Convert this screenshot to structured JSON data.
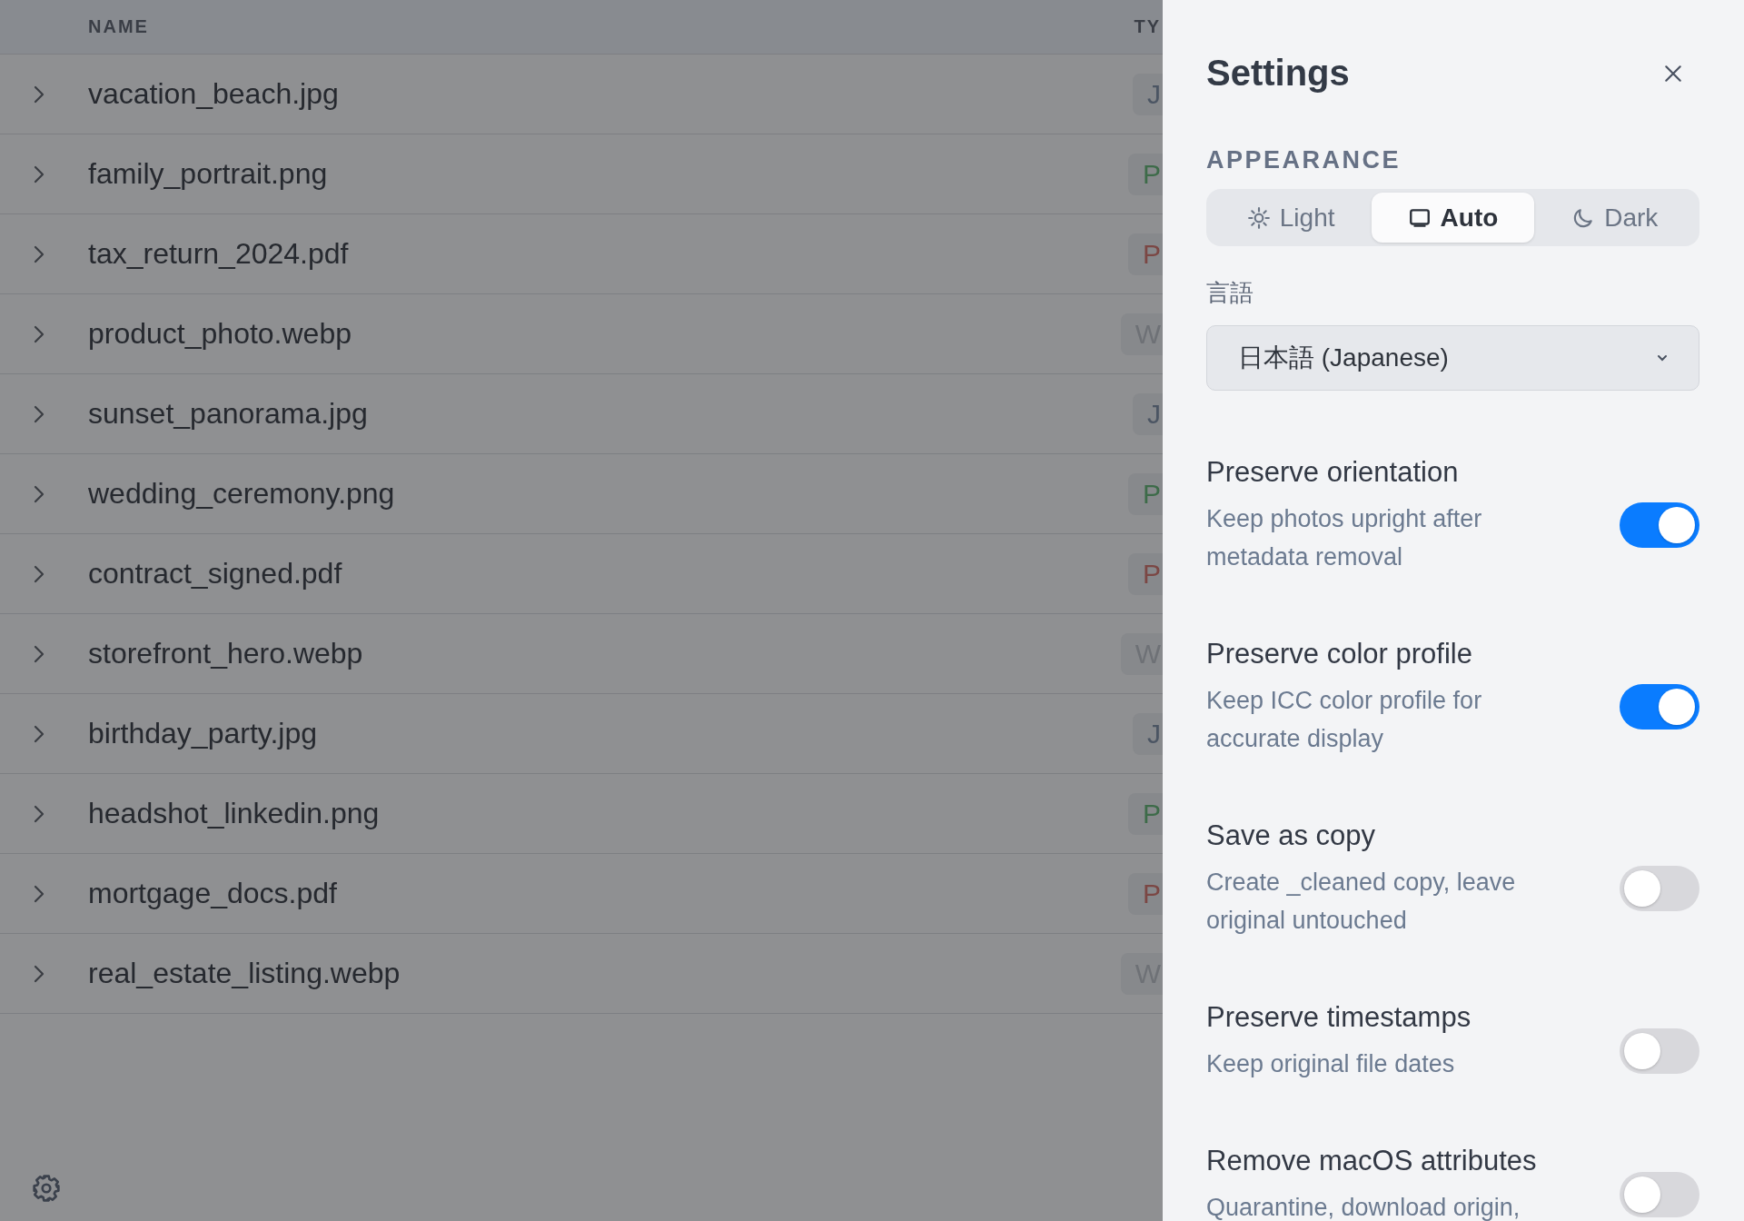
{
  "table": {
    "columns": [
      "NAME",
      "TY"
    ],
    "rows": [
      {
        "name": "vacation_beach.jpg",
        "type": "J",
        "color": "#4b5563"
      },
      {
        "name": "family_portrait.png",
        "type": "P",
        "color": "#3d6b49"
      },
      {
        "name": "tax_return_2024.pdf",
        "type": "P",
        "color": "#7b4744"
      },
      {
        "name": "product_photo.webp",
        "type": "W",
        "color": "#6e7176"
      },
      {
        "name": "sunset_panorama.jpg",
        "type": "J",
        "color": "#4b5563"
      },
      {
        "name": "wedding_ceremony.png",
        "type": "P",
        "color": "#3d6b49"
      },
      {
        "name": "contract_signed.pdf",
        "type": "P",
        "color": "#7b4744"
      },
      {
        "name": "storefront_hero.webp",
        "type": "W",
        "color": "#6e7176"
      },
      {
        "name": "birthday_party.jpg",
        "type": "J",
        "color": "#4b5563"
      },
      {
        "name": "headshot_linkedin.png",
        "type": "P",
        "color": "#3d6b49"
      },
      {
        "name": "mortgage_docs.pdf",
        "type": "P",
        "color": "#7b4744"
      },
      {
        "name": "real_estate_listing.webp",
        "type": "W",
        "color": "#6e7176"
      }
    ]
  },
  "settings": {
    "title": "Settings",
    "appearance_label": "APPEARANCE",
    "themes": [
      {
        "kind": "sun",
        "label": "Light",
        "selected": false
      },
      {
        "kind": "monitor",
        "label": "Auto",
        "selected": true
      },
      {
        "kind": "moon",
        "label": "Dark",
        "selected": false
      }
    ],
    "language_label": "言語",
    "language_value": "日本語 (Japanese)",
    "options": [
      {
        "title": "Preserve orientation",
        "description": "Keep photos upright after metadata removal",
        "on": true
      },
      {
        "title": "Preserve color profile",
        "description": "Keep ICC color profile for accurate display",
        "on": true
      },
      {
        "title": "Save as copy",
        "description": "Create _cleaned copy, leave original untouched",
        "on": false
      },
      {
        "title": "Preserve timestamps",
        "description": "Keep original file dates",
        "on": false
      },
      {
        "title": "Remove macOS attributes",
        "description": "Quarantine, download origin,",
        "on": false
      }
    ]
  }
}
